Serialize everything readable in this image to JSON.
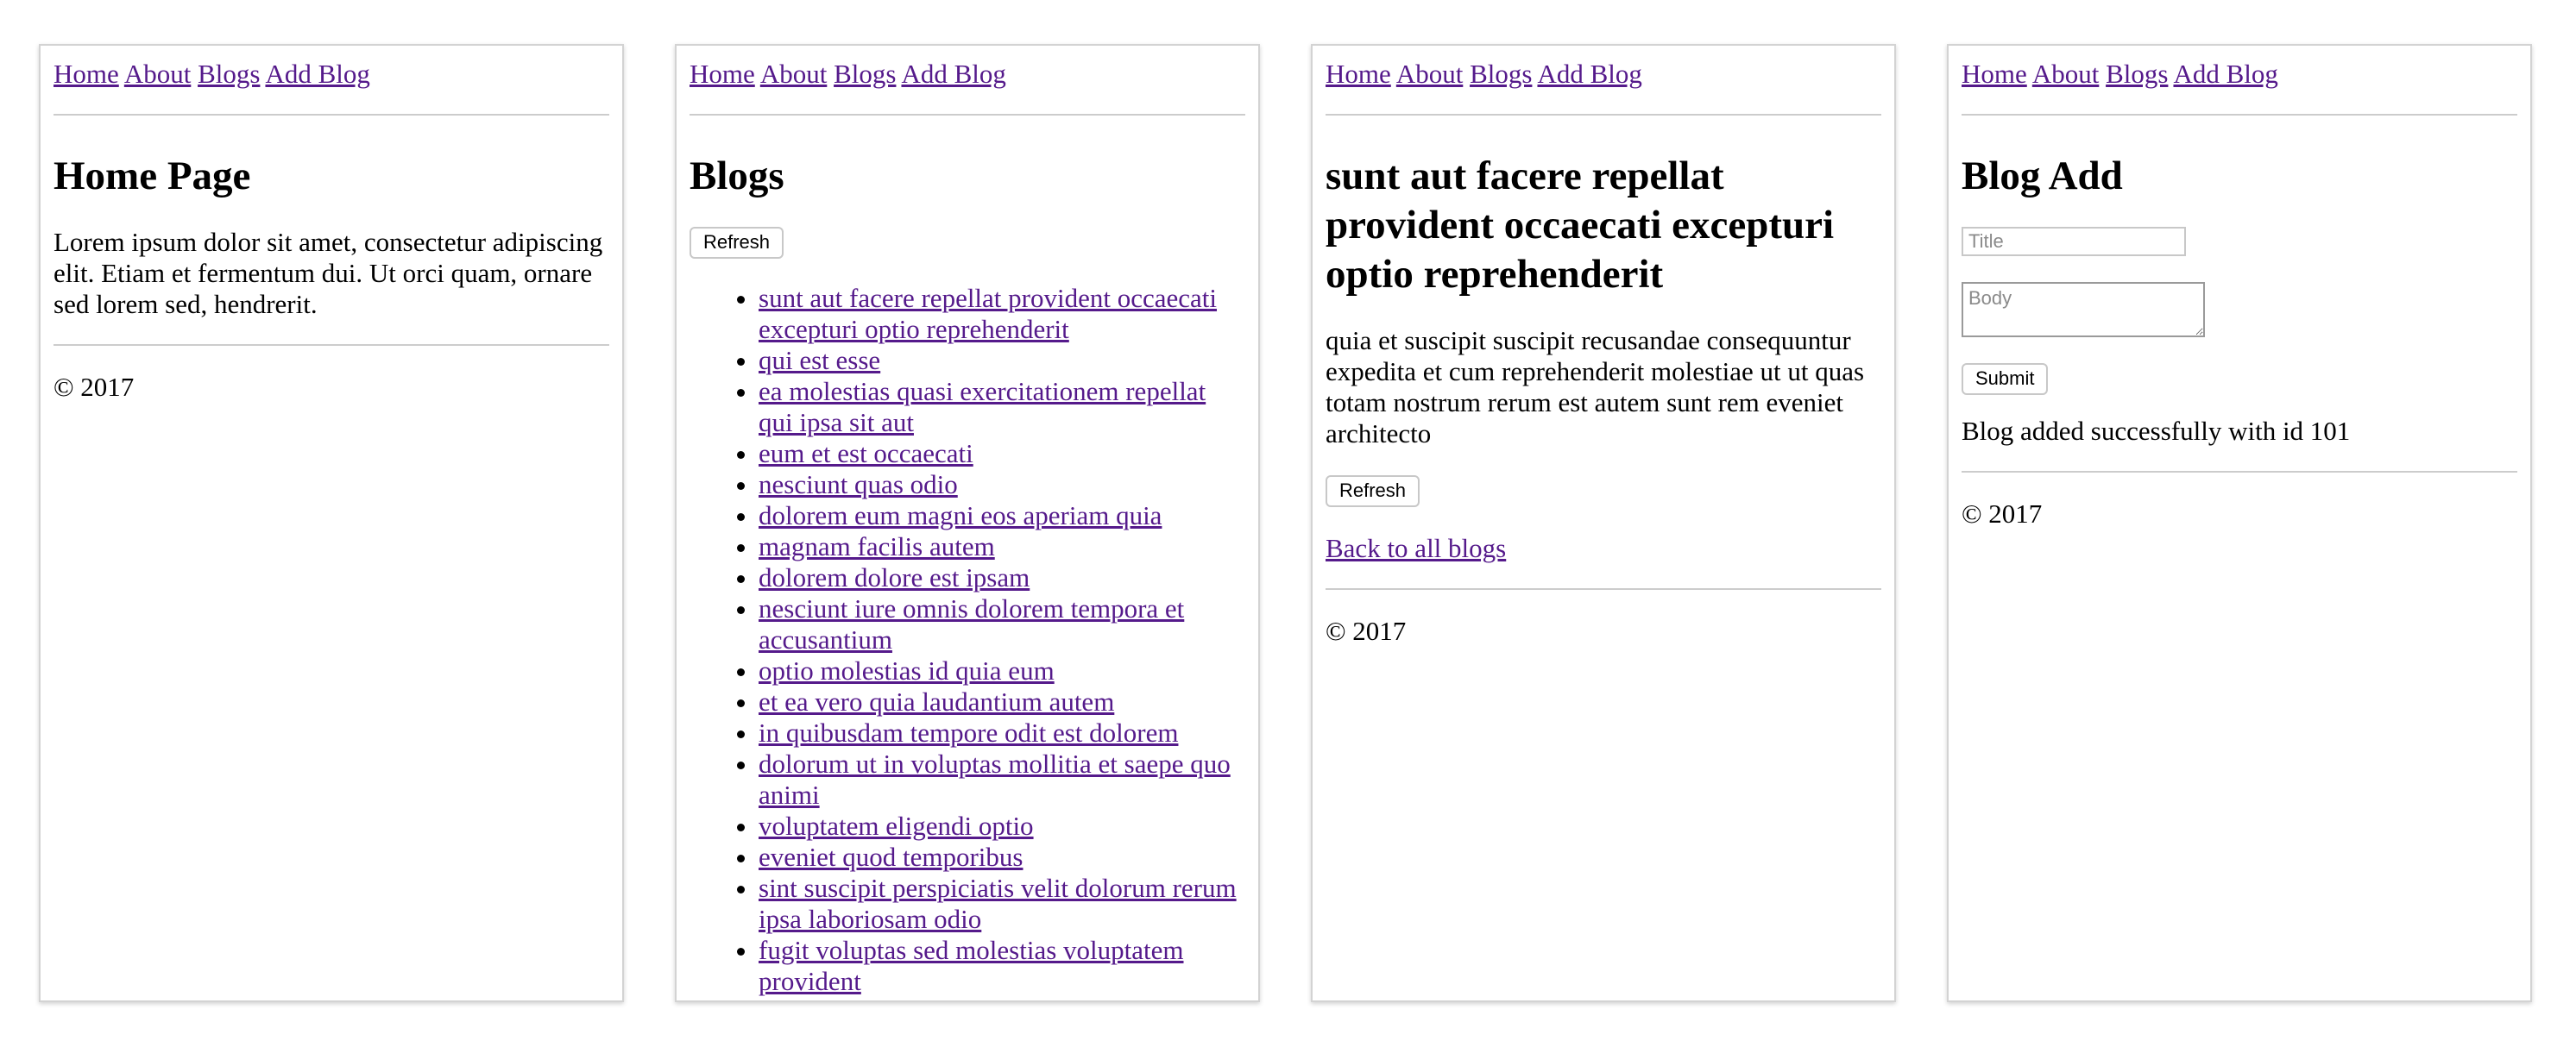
{
  "nav": {
    "home": "Home",
    "about": "About",
    "blogs": "Blogs",
    "add_blog": "Add Blog"
  },
  "footer": "© 2017",
  "home_page": {
    "heading": "Home Page",
    "body": "Lorem ipsum dolor sit amet, consectetur adipiscing elit. Etiam et fermentum dui. Ut orci quam, ornare sed lorem sed, hendrerit."
  },
  "blogs_page": {
    "heading": "Blogs",
    "refresh_label": "Refresh",
    "items": [
      "sunt aut facere repellat provident occaecati excepturi optio reprehenderit",
      "qui est esse",
      "ea molestias quasi exercitationem repellat qui ipsa sit aut",
      "eum et est occaecati",
      "nesciunt quas odio",
      "dolorem eum magni eos aperiam quia",
      "magnam facilis autem",
      "dolorem dolore est ipsam",
      "nesciunt iure omnis dolorem tempora et accusantium",
      "optio molestias id quia eum",
      "et ea vero quia laudantium autem",
      "in quibusdam tempore odit est dolorem",
      "dolorum ut in voluptas mollitia et saepe quo animi",
      "voluptatem eligendi optio",
      "eveniet quod temporibus",
      "sint suscipit perspiciatis velit dolorum rerum ipsa laboriosam odio",
      "fugit voluptas sed molestias voluptatem provident"
    ]
  },
  "post_page": {
    "heading": "sunt aut facere repellat provident occaecati excepturi optio reprehenderit",
    "body": "quia et suscipit suscipit recusandae consequuntur expedita et cum reprehenderit molestiae ut ut quas totam nostrum rerum est autem sunt rem eveniet architecto",
    "refresh_label": "Refresh",
    "back_link": "Back to all blogs"
  },
  "add_page": {
    "heading": "Blog Add",
    "title_placeholder": "Title",
    "body_placeholder": "Body",
    "submit_label": "Submit",
    "status": "Blog added successfully with id 101"
  }
}
